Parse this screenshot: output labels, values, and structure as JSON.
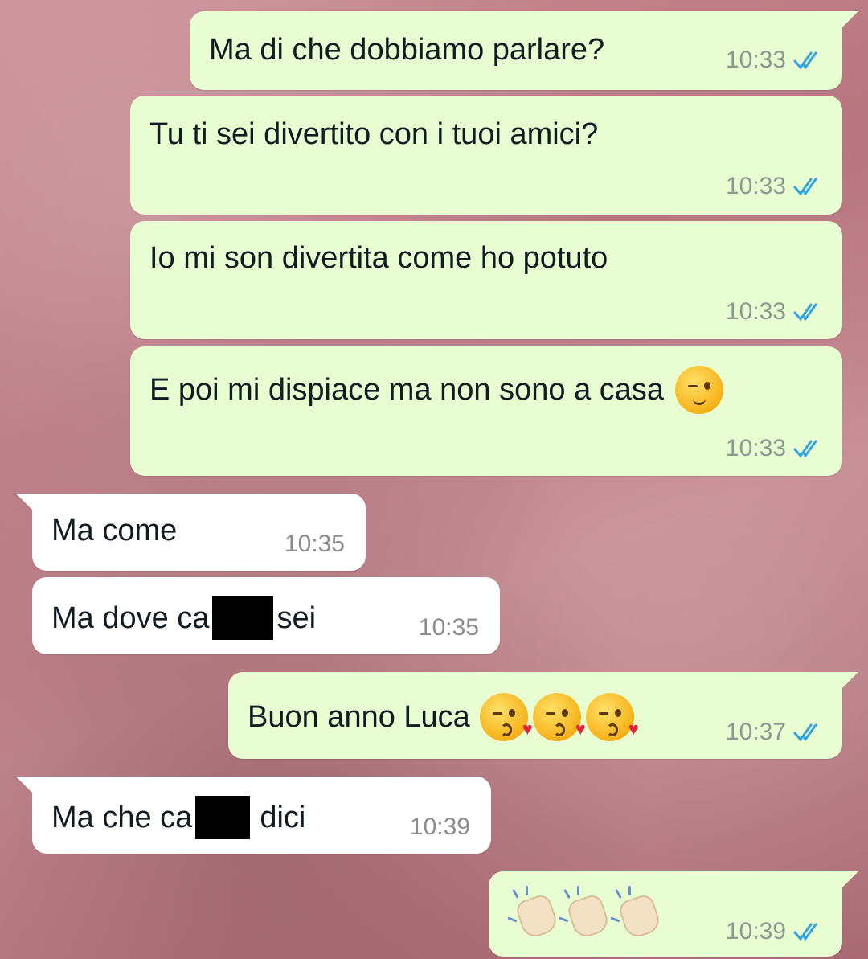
{
  "colors": {
    "outgoing_bubble": "#e9fdd2",
    "incoming_bubble": "#ffffff",
    "read_ticks": "#34a3e0",
    "wallpaper": "#b77680"
  },
  "messages": [
    {
      "direction": "out",
      "text": "Ma di che dobbiamo parlare?",
      "time": "10:33",
      "status": "read"
    },
    {
      "direction": "out",
      "text": "Tu ti sei divertito con i tuoi amici?",
      "time": "10:33",
      "status": "read"
    },
    {
      "direction": "out",
      "text": "Io mi son divertita come ho potuto",
      "time": "10:33",
      "status": "read"
    },
    {
      "direction": "out",
      "text": "E poi mi dispiace ma non sono a casa",
      "emoji": "winking-face",
      "time": "10:33",
      "status": "read"
    },
    {
      "direction": "in",
      "text": "Ma come",
      "time": "10:35"
    },
    {
      "direction": "in",
      "text_before": "Ma dove ca",
      "text_after": "sei",
      "redacted": true,
      "time": "10:35"
    },
    {
      "direction": "out",
      "text": "Buon anno Luca",
      "emoji": "face-blowing-kiss x3",
      "time": "10:37",
      "status": "read"
    },
    {
      "direction": "in",
      "text_before": "Ma che ca",
      "text_after": "dici",
      "redacted": true,
      "time": "10:39"
    },
    {
      "direction": "out",
      "emoji": "clapping-hands x3",
      "time": "10:39",
      "status": "read"
    }
  ]
}
